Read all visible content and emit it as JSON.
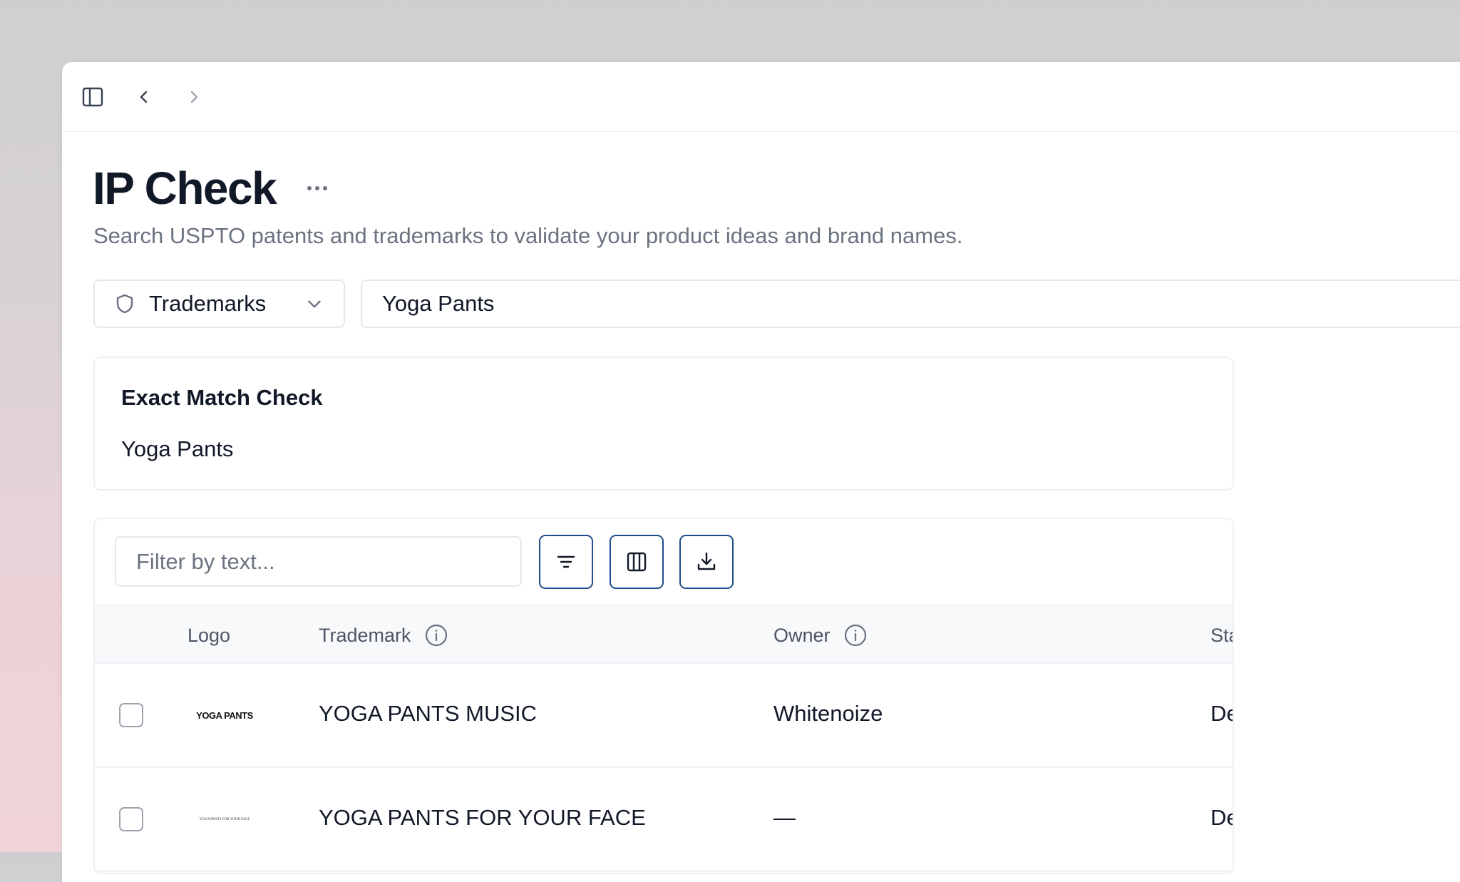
{
  "page": {
    "title": "IP Check",
    "subtitle": "Search USPTO patents and trademarks to validate your product ideas and brand names."
  },
  "search": {
    "type_label": "Trademarks",
    "query": "Yoga Pants"
  },
  "exact_match": {
    "heading": "Exact Match Check",
    "term": "Yoga Pants"
  },
  "table": {
    "filter_placeholder": "Filter by text...",
    "columns": {
      "logo": "Logo",
      "trademark": "Trademark",
      "owner": "Owner",
      "status": "Status"
    },
    "rows": [
      {
        "logo_text": "YOGA PANTS",
        "trademark": "YOGA PANTS MUSIC",
        "owner": "Whitenoize",
        "status": "Dead/Abandoned"
      },
      {
        "logo_text": "YOGA PANTS FOR YOUR FACE",
        "trademark": "YOGA PANTS FOR YOUR FACE",
        "owner": "—",
        "status": "Dead/Abandoned"
      }
    ]
  },
  "icons": {
    "toolbar": [
      "sidebar-toggle-icon",
      "chevron-left-icon",
      "chevron-right-icon"
    ],
    "select": "shield-icon",
    "table_tools": [
      "filter-icon",
      "columns-icon",
      "download-icon"
    ]
  },
  "colors": {
    "accent_border": "#1e4d8c",
    "text_primary": "#111827",
    "text_muted": "#6b7280"
  }
}
